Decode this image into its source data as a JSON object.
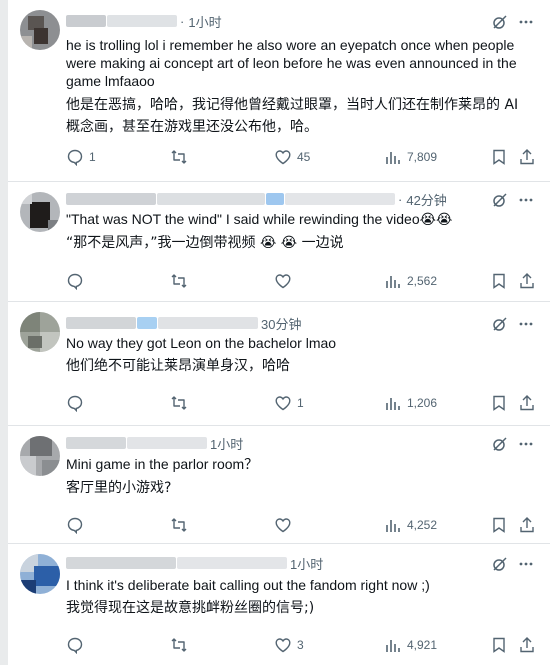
{
  "replies": [
    {
      "time": "1小时",
      "text": "he is trolling lol i remember he also wore an eyepatch once when people were making ai concept art of leon before he was even announced in the game lmfaaoo",
      "translation": "他是在恶搞，哈哈，我记得他曾经戴过眼罩，当时人们还在制作莱昂的 AI 概念画，甚至在游戏里还没公布他，哈。",
      "replies_count": "1",
      "retweets_count": "",
      "likes_count": "45",
      "views_count": "7,809"
    },
    {
      "time": "42分钟",
      "text": "\"That was NOT the wind\" I said while rewinding the video😭😭",
      "translation": "“那不是风声，”我一边倒带视频 😭 😭 一边说",
      "replies_count": "",
      "retweets_count": "",
      "likes_count": "",
      "views_count": "2,562"
    },
    {
      "time": "30分钟",
      "text": "No way they got Leon on the bachelor lmao",
      "translation": "他们绝不可能让莱昂演单身汉，哈哈",
      "replies_count": "",
      "retweets_count": "",
      "likes_count": "1",
      "views_count": "1,206"
    },
    {
      "time": "1小时",
      "text": "Mini game in the parlor room？",
      "translation": "客厅里的小游戏?",
      "replies_count": "",
      "retweets_count": "",
      "likes_count": "",
      "views_count": "4,252"
    },
    {
      "time": "1小时",
      "text": "I think it's deliberate bait calling out the fandom right now ;)",
      "translation": "我觉得现在这是故意挑衅粉丝圈的信号;)",
      "replies_count": "",
      "retweets_count": "",
      "likes_count": "3",
      "views_count": "4,921"
    }
  ],
  "icons": {
    "top": [
      "grok-icon",
      "more-icon"
    ],
    "actions": [
      "reply-icon",
      "retweet-icon",
      "like-icon",
      "views-icon",
      "bookmark-icon",
      "share-icon"
    ]
  },
  "colors": {
    "text": "#0f1419",
    "secondary": "#536471",
    "divider": "#e1e4e7"
  }
}
